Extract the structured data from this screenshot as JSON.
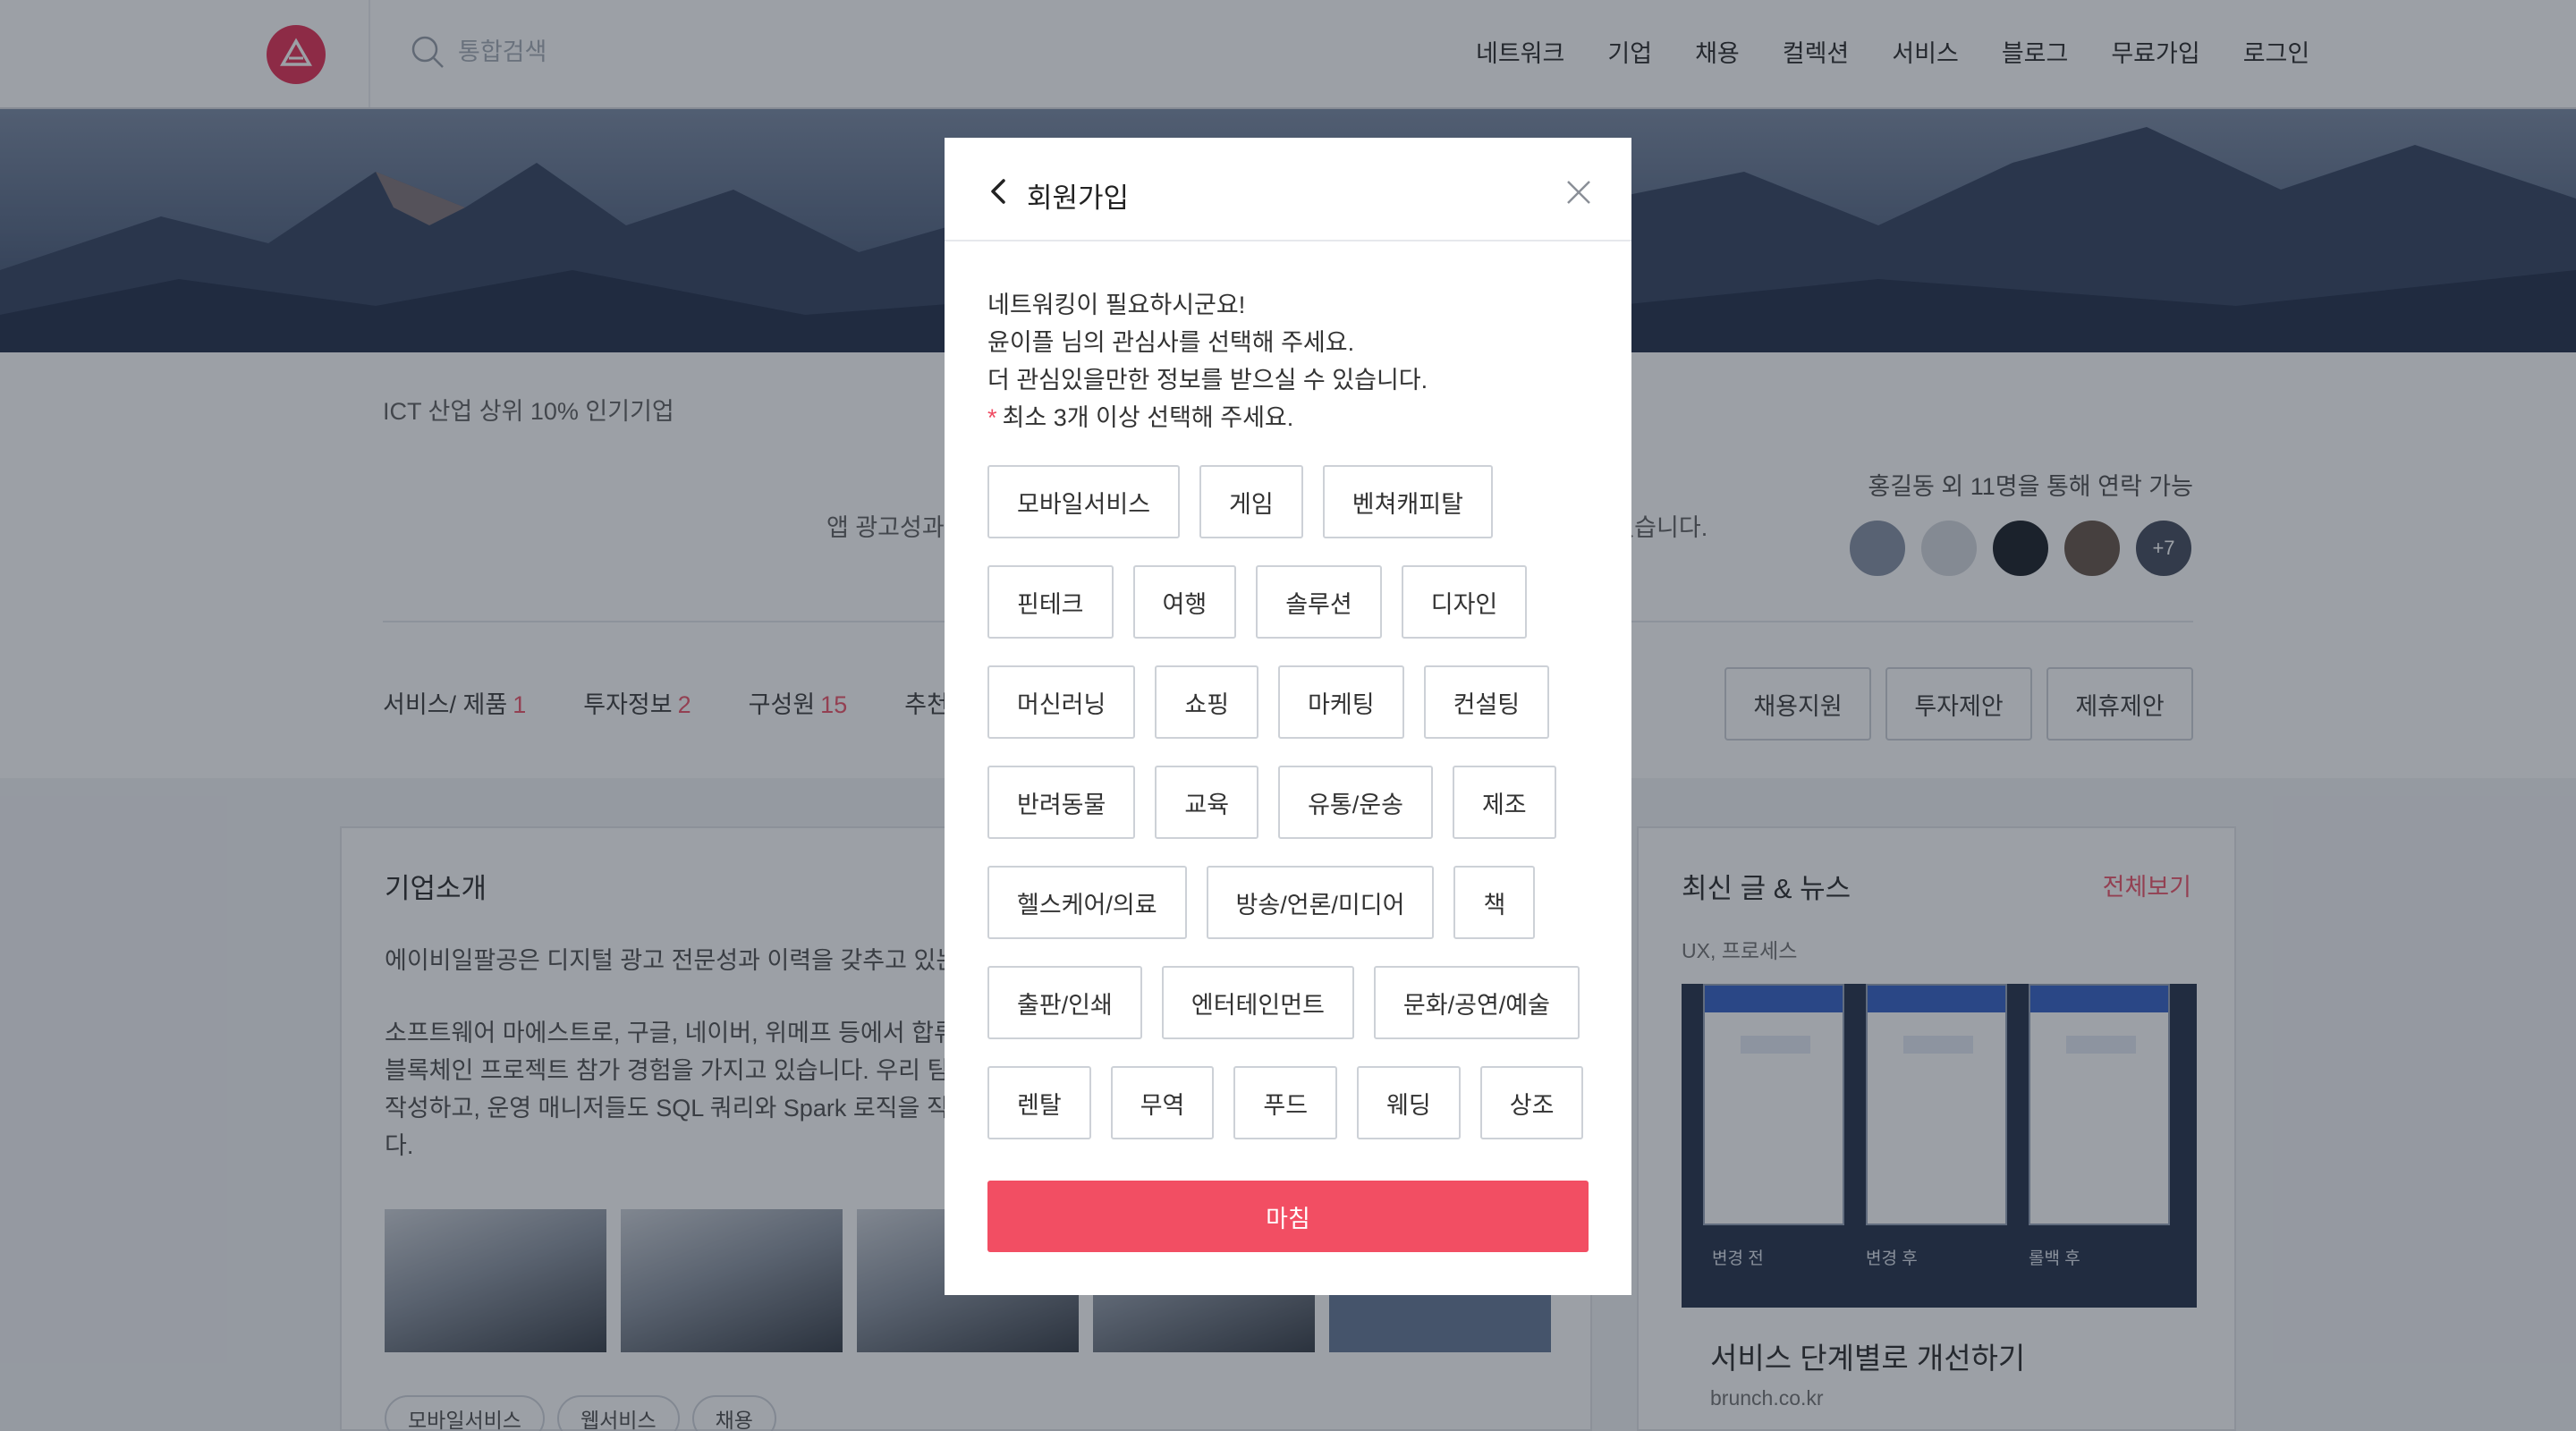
{
  "header": {
    "logo_icon": "delta-logo-icon",
    "search": {
      "placeholder": "통합검색"
    },
    "nav": [
      "네트워크",
      "기업",
      "채용",
      "컬렉션",
      "서비스",
      "블로그",
      "무료가입",
      "로그인"
    ]
  },
  "company": {
    "tagline": "ICT 산업 상위 10% 인기기업",
    "desc_visible": "앱 광고성과",
    "desc_visible_end": "고 있습니다.",
    "contact_line": "홍길동 외 11명을 통해 연락 가능",
    "avatars_more": "+7",
    "tabs": [
      {
        "label": "서비스/ 제품",
        "count": "1"
      },
      {
        "label": "투자정보",
        "count": "2"
      },
      {
        "label": "구성원",
        "count": "15"
      },
      {
        "label": "추천",
        "count": ""
      }
    ],
    "actions": [
      "채용지원",
      "투자제안",
      "제휴제안"
    ]
  },
  "about": {
    "title": "기업소개",
    "p1": "에이비일팔공은 디지털 광고 전문성과 이력을 갖추고 있는",
    "p2_lines": [
      "소프트웨어 마에스트로, 구글, 네이버, 위메프 등에서 합류한",
      "블록체인 프로젝트 참가 경험을 가지고 있습니다. 우리 팀에",
      "작성하고, 운영 매니저들도 SQL 쿼리와 Spark 로직을 직접",
      "다."
    ],
    "tags": [
      "모바일서비스",
      "웹서비스",
      "채용"
    ]
  },
  "news": {
    "title": "최신 글 & 뉴스",
    "view_all": "전체보기",
    "category": "UX, 프로세스",
    "image_captions": [
      "변경 전",
      "변경 후",
      "롤백 후"
    ],
    "headline": "서비스 단계별로 개선하기",
    "source": "brunch.co.kr"
  },
  "modal": {
    "title": "회원가입",
    "back_icon": "chevron-left-icon",
    "close_icon": "close-icon",
    "intro": [
      "네트워킹이 필요하시군요!",
      "윤이플 님의 관심사를 선택해 주세요.",
      "더 관심있을만한 정보를 받으실 수 있습니다."
    ],
    "required_mark": "*",
    "min_note": "최소 3개 이상 선택해 주세요.",
    "chip_rows": [
      [
        "모바일서비스",
        "게임",
        "벤쳐캐피탈"
      ],
      [
        "핀테크",
        "여행",
        "솔루션",
        "디자인"
      ],
      [
        "머신러닝",
        "쇼핑",
        "마케팅",
        "컨설팅"
      ],
      [
        "반려동물",
        "교육",
        "유통/운송",
        "제조"
      ],
      [
        "헬스케어/의료",
        "방송/언론/미디어",
        "책"
      ],
      [
        "출판/인쇄",
        "엔터테인먼트",
        "문화/공연/예술"
      ],
      [
        "렌탈",
        "무역",
        "푸드",
        "웨딩",
        "상조"
      ]
    ],
    "finish": "마침",
    "accent_color": "#f24e63"
  }
}
